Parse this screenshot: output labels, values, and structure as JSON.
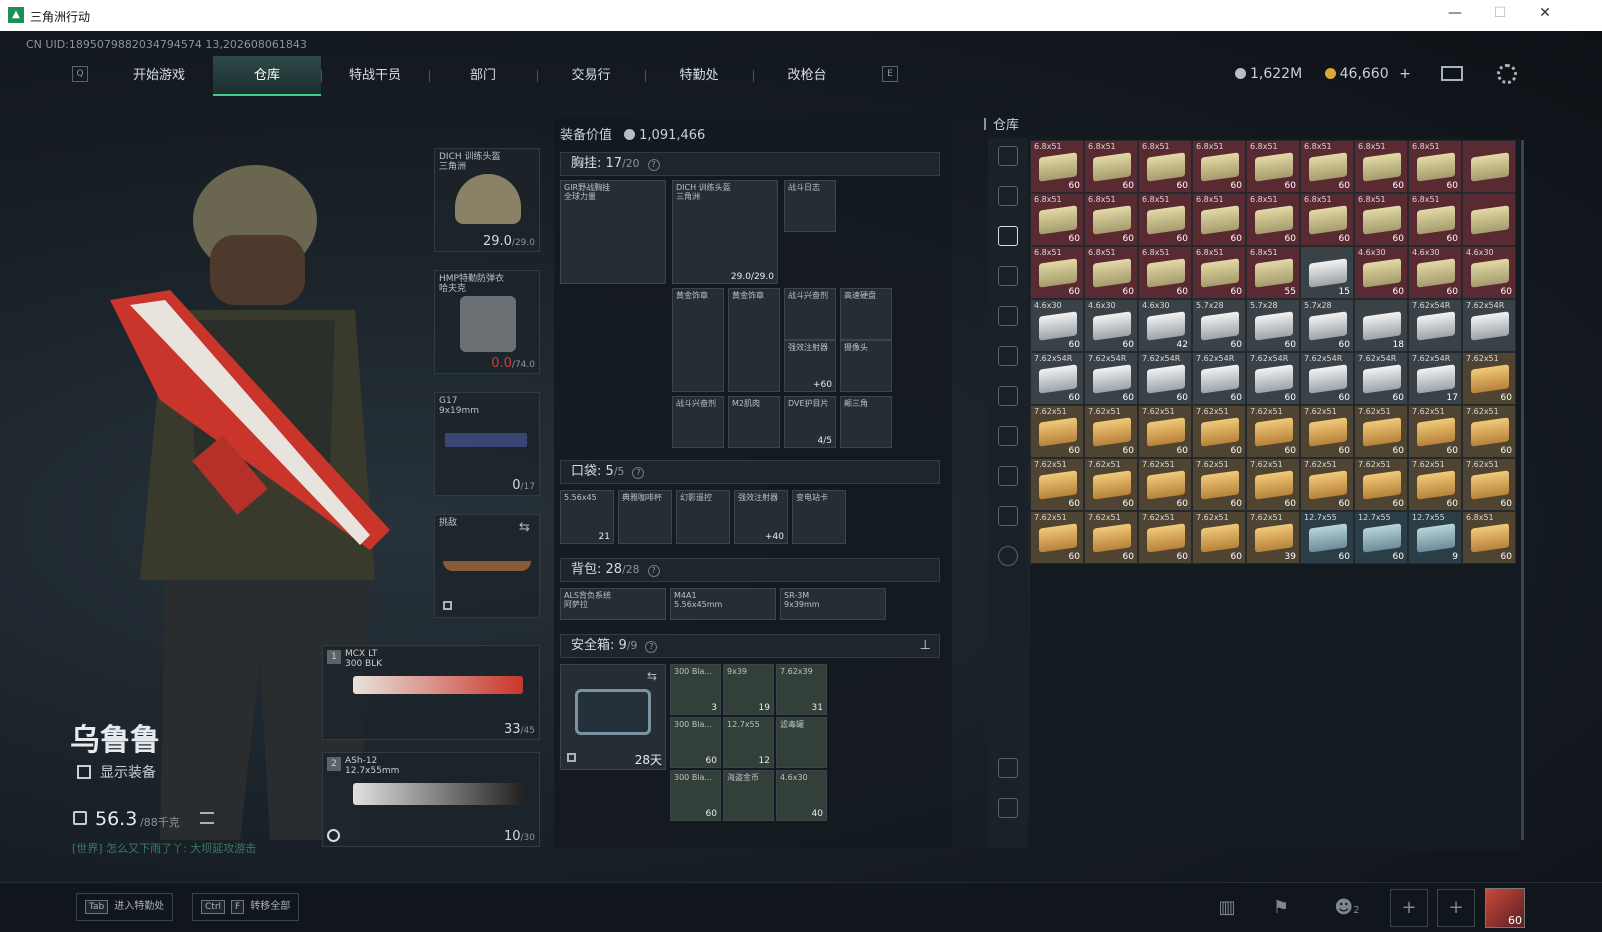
{
  "window": {
    "title": "三角洲行动",
    "minimize": "—",
    "maximize": "☐",
    "close": "✕"
  },
  "uid": "CN UID:1895079882034794574 13,202608061843",
  "nav": {
    "left_key": "Q",
    "right_key": "E",
    "tabs": [
      "开始游戏",
      "仓库",
      "特战干员",
      "部门",
      "交易行",
      "特勤处",
      "改枪台"
    ],
    "active": 1
  },
  "currency": {
    "silver": "1,622M",
    "gold": "46,660",
    "plus": "+"
  },
  "character": {
    "name": "乌鲁鲁",
    "show_equip": "显示装备",
    "weight": "56.3",
    "weight_max": "/88千克",
    "chat": "[世界] 怎么又下雨了丫: 大坝延攻游击"
  },
  "gear": {
    "helmet": {
      "label": "DICH 训练头盔\n三角洲",
      "value": "29.0",
      "max": "/29.0"
    },
    "armor": {
      "label": "HMP特勤防弹衣\n哈夫克",
      "value": "0.0",
      "max": "/74.0"
    },
    "pistol": {
      "label": "G17\n9x19mm",
      "value": "0",
      "max": "/17"
    },
    "melee": {
      "label": "挑敌"
    },
    "primary": {
      "slot": "1",
      "label": "MCX LT\n300 BLK",
      "value": "33",
      "max": "/45"
    },
    "secondary": {
      "slot": "2",
      "label": "ASh-12\n12.7x55mm",
      "value": "10",
      "max": "/30"
    }
  },
  "equip": {
    "value_label": "装备价值",
    "value": "1,091,466",
    "rig": {
      "title": "胸挂:",
      "used": "17",
      "cap": "/20",
      "q": "?"
    },
    "rig_items": [
      {
        "label": "GIR野战胸挂\n全球力量",
        "num": ""
      },
      {
        "label": "DICH 训练头盔\n三角洲",
        "num": "29.0/29.0"
      },
      {
        "label": "战斗日志",
        "num": ""
      },
      {
        "label": "黄金饰章",
        "num": ""
      },
      {
        "label": "黄金饰章",
        "num": ""
      },
      {
        "label": "战斗兴奋剂",
        "num": ""
      },
      {
        "label": "高速硬盘",
        "num": ""
      },
      {
        "label": "强效注射器",
        "num": "+60"
      },
      {
        "label": "摄像头",
        "num": ""
      },
      {
        "label": "战斗兴奋剂",
        "num": ""
      },
      {
        "label": "M2肌肉",
        "num": ""
      },
      {
        "label": "DVE护目片",
        "num": "4/5"
      },
      {
        "label": "颠三角",
        "num": ""
      }
    ],
    "pocket": {
      "title": "口袋:",
      "used": "5",
      "cap": "/5",
      "q": "?"
    },
    "pocket_items": [
      {
        "label": "5.56x45",
        "num": "21"
      },
      {
        "label": "典雅咖啡杯",
        "num": ""
      },
      {
        "label": "幻影遥控",
        "num": ""
      },
      {
        "label": "强效注射器",
        "num": "+40"
      },
      {
        "label": "变电站卡",
        "num": ""
      }
    ],
    "backpack": {
      "title": "背包:",
      "used": "28",
      "cap": "/28",
      "q": "?"
    },
    "backpack_items": [
      {
        "label": "ALS背负系统\n阿萨拉"
      },
      {
        "label": "M4A1\n5.56x45mm"
      },
      {
        "label": "SR-3M\n9x39mm"
      }
    ],
    "safebox": {
      "title": "安全箱:",
      "used": "9",
      "cap": "/9",
      "q": "?",
      "days": "28天"
    },
    "safebox_items": [
      {
        "label": "300 Bla...",
        "num": "3"
      },
      {
        "label": "9x39",
        "num": "19"
      },
      {
        "label": "7.62x39",
        "num": "31"
      },
      {
        "label": "300 Bla...",
        "num": "60"
      },
      {
        "label": "12.7x55",
        "num": "12"
      },
      {
        "label": "滤毒罐",
        "num": ""
      },
      {
        "label": "300 Bla...",
        "num": "60"
      },
      {
        "label": "海盗金币",
        "num": ""
      },
      {
        "label": "4.6x30",
        "num": "40"
      }
    ]
  },
  "warehouse": {
    "title": "仓库",
    "cells": [
      {
        "n": "6.8x51",
        "c": "60",
        "t": "am"
      },
      {
        "n": "6.8x51",
        "c": "60",
        "t": "am"
      },
      {
        "n": "6.8x51",
        "c": "60",
        "t": "am"
      },
      {
        "n": "6.8x51",
        "c": "60",
        "t": "am"
      },
      {
        "n": "6.8x51",
        "c": "60",
        "t": "am"
      },
      {
        "n": "6.8x51",
        "c": "60",
        "t": "am"
      },
      {
        "n": "6.8x51",
        "c": "60",
        "t": "am"
      },
      {
        "n": "6.8x51",
        "c": "60",
        "t": "am"
      },
      {
        "n": "",
        "c": "",
        "t": "am"
      },
      {
        "n": "6.8x51",
        "c": "60",
        "t": "am"
      },
      {
        "n": "6.8x51",
        "c": "60",
        "t": "am"
      },
      {
        "n": "6.8x51",
        "c": "60",
        "t": "am"
      },
      {
        "n": "6.8x51",
        "c": "60",
        "t": "am"
      },
      {
        "n": "6.8x51",
        "c": "60",
        "t": "am"
      },
      {
        "n": "6.8x51",
        "c": "60",
        "t": "am"
      },
      {
        "n": "6.8x51",
        "c": "60",
        "t": "am"
      },
      {
        "n": "6.8x51",
        "c": "60",
        "t": "am"
      },
      {
        "n": "",
        "c": "",
        "t": "am"
      },
      {
        "n": "6.8x51",
        "c": "60",
        "t": "am"
      },
      {
        "n": "6.8x51",
        "c": "60",
        "t": "am"
      },
      {
        "n": "6.8x51",
        "c": "60",
        "t": "am"
      },
      {
        "n": "6.8x51",
        "c": "60",
        "t": "am"
      },
      {
        "n": "6.8x51",
        "c": "55",
        "t": "am"
      },
      {
        "n": "",
        "c": "15",
        "t": "gr"
      },
      {
        "n": "4.6x30",
        "c": "60",
        "t": "am"
      },
      {
        "n": "4.6x30",
        "c": "60",
        "t": "am"
      },
      {
        "n": "4.6x30",
        "c": "60",
        "t": "am"
      },
      {
        "n": "4.6x30",
        "c": "60",
        "t": "gr"
      },
      {
        "n": "4.6x30",
        "c": "60",
        "t": "gr"
      },
      {
        "n": "4.6x30",
        "c": "42",
        "t": "gr"
      },
      {
        "n": "5.7x28",
        "c": "60",
        "t": "gr"
      },
      {
        "n": "5.7x28",
        "c": "60",
        "t": "gr"
      },
      {
        "n": "5.7x28",
        "c": "60",
        "t": "gr"
      },
      {
        "n": "",
        "c": "18",
        "t": "gr"
      },
      {
        "n": "7.62x54R",
        "c": "",
        "t": "gr"
      },
      {
        "n": "7.62x54R",
        "c": "",
        "t": "gr"
      },
      {
        "n": "7.62x54R",
        "c": "60",
        "t": "gr"
      },
      {
        "n": "7.62x54R",
        "c": "60",
        "t": "gr"
      },
      {
        "n": "7.62x54R",
        "c": "60",
        "t": "gr"
      },
      {
        "n": "7.62x54R",
        "c": "60",
        "t": "gr"
      },
      {
        "n": "7.62x54R",
        "c": "60",
        "t": "gr"
      },
      {
        "n": "7.62x54R",
        "c": "60",
        "t": "gr"
      },
      {
        "n": "7.62x54R",
        "c": "60",
        "t": "gr"
      },
      {
        "n": "7.62x54R",
        "c": "17",
        "t": "gr"
      },
      {
        "n": "7.62x51",
        "c": "60",
        "t": "go"
      },
      {
        "n": "7.62x51",
        "c": "60",
        "t": "go"
      },
      {
        "n": "7.62x51",
        "c": "60",
        "t": "go"
      },
      {
        "n": "7.62x51",
        "c": "60",
        "t": "go"
      },
      {
        "n": "7.62x51",
        "c": "60",
        "t": "go"
      },
      {
        "n": "7.62x51",
        "c": "60",
        "t": "go"
      },
      {
        "n": "7.62x51",
        "c": "60",
        "t": "go"
      },
      {
        "n": "7.62x51",
        "c": "60",
        "t": "go"
      },
      {
        "n": "7.62x51",
        "c": "60",
        "t": "go"
      },
      {
        "n": "7.62x51",
        "c": "60",
        "t": "go"
      },
      {
        "n": "7.62x51",
        "c": "60",
        "t": "go"
      },
      {
        "n": "7.62x51",
        "c": "60",
        "t": "go"
      },
      {
        "n": "7.62x51",
        "c": "60",
        "t": "go"
      },
      {
        "n": "7.62x51",
        "c": "60",
        "t": "go"
      },
      {
        "n": "7.62x51",
        "c": "60",
        "t": "go"
      },
      {
        "n": "7.62x51",
        "c": "60",
        "t": "go"
      },
      {
        "n": "7.62x51",
        "c": "60",
        "t": "go"
      },
      {
        "n": "7.62x51",
        "c": "60",
        "t": "go"
      },
      {
        "n": "7.62x51",
        "c": "60",
        "t": "go"
      },
      {
        "n": "7.62x51",
        "c": "60",
        "t": "go"
      },
      {
        "n": "7.62x51",
        "c": "60",
        "t": "go"
      },
      {
        "n": "7.62x51",
        "c": "60",
        "t": "go"
      },
      {
        "n": "7.62x51",
        "c": "60",
        "t": "go"
      },
      {
        "n": "7.62x51",
        "c": "39",
        "t": "go"
      },
      {
        "n": "12.7x55",
        "c": "60",
        "t": "bl"
      },
      {
        "n": "12.7x55",
        "c": "60",
        "t": "bl"
      },
      {
        "n": "12.7x55",
        "c": "9",
        "t": "bl"
      },
      {
        "n": "6.8x51",
        "c": "60",
        "t": "go"
      }
    ]
  },
  "bottom": {
    "tab_key": "Tab",
    "tab_label": "进入特勤处",
    "ctrl_key": "Ctrl",
    "f_key": "F",
    "transfer_label": "转移全部",
    "friends": "2",
    "avatar_level": "60"
  },
  "colors": {
    "accent": "#3ecf8e",
    "ammo_red": "#5a2a32",
    "gold_box": "#b7823a"
  }
}
